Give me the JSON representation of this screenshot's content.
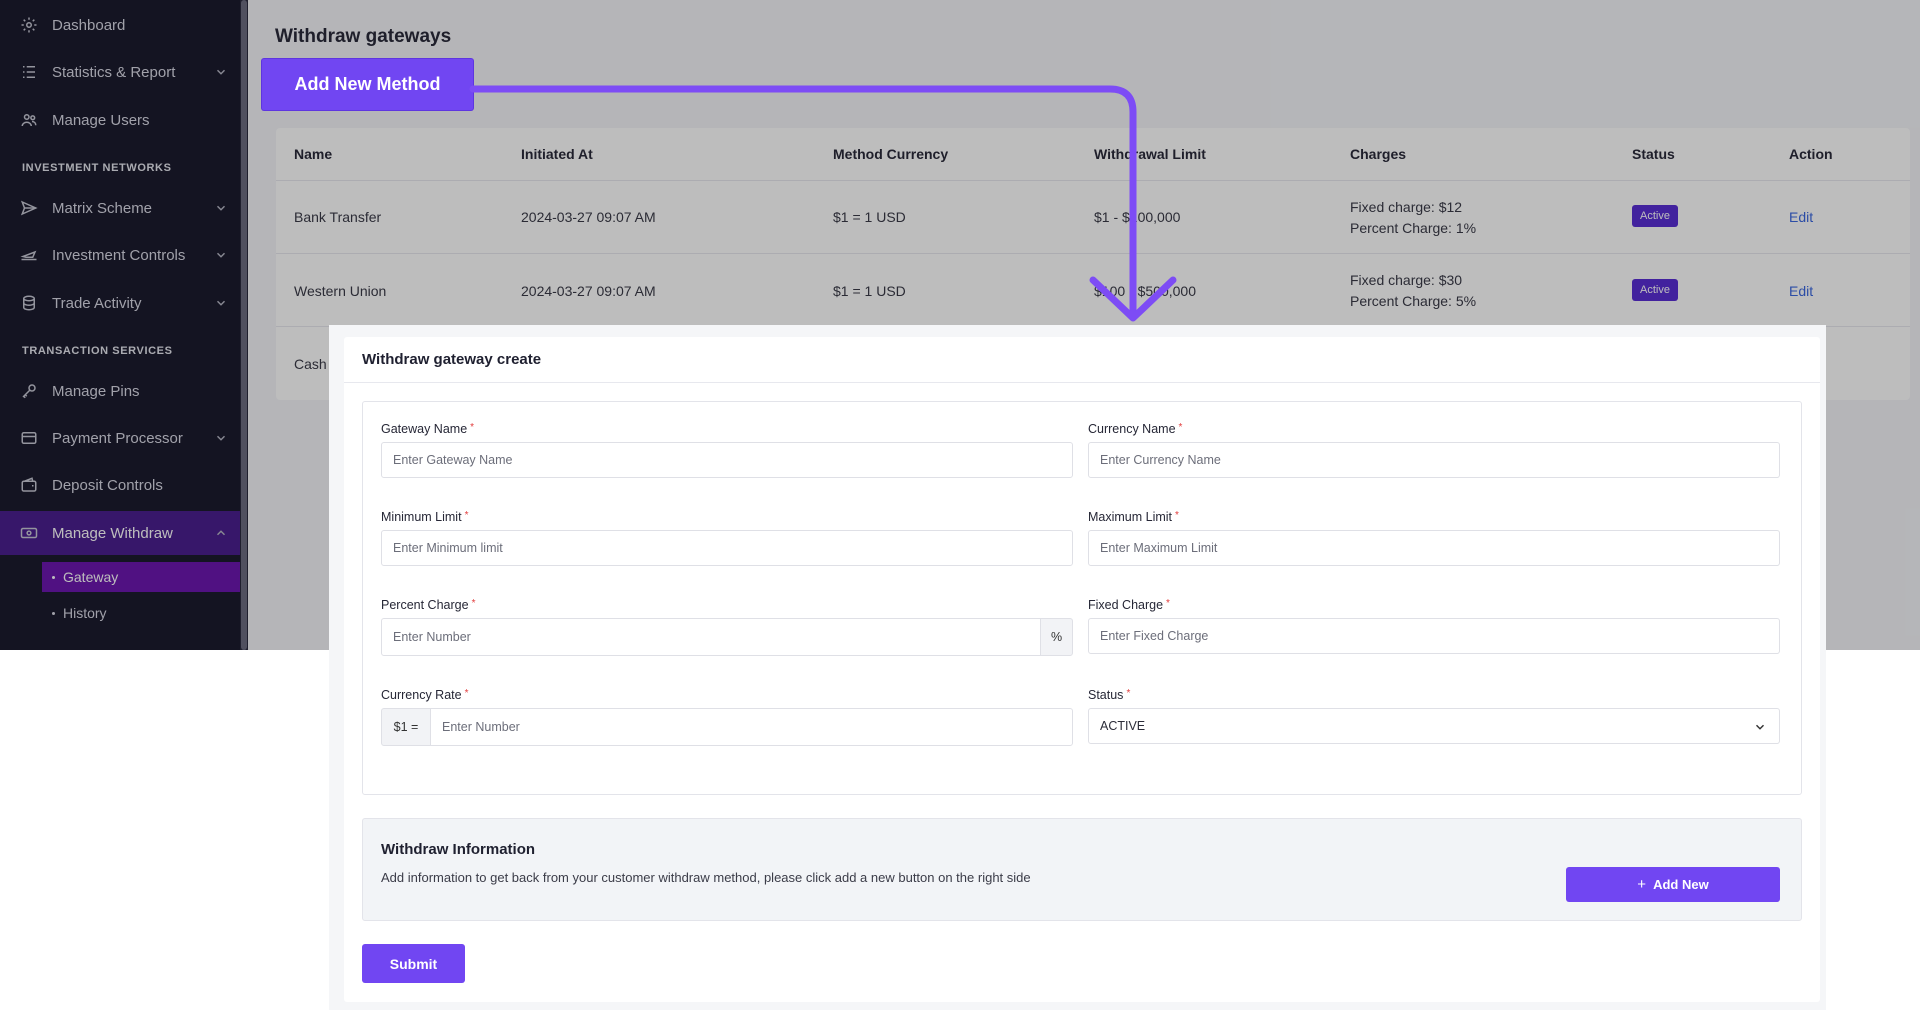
{
  "sidebar": {
    "items": [
      {
        "label": "Dashboard",
        "icon": "gear-icon"
      },
      {
        "label": "Statistics & Report",
        "icon": "list-icon"
      },
      {
        "label": "Manage Users",
        "icon": "users-icon"
      },
      {
        "label": "Matrix Scheme",
        "icon": "send-icon"
      },
      {
        "label": "Investment Controls",
        "icon": "plane-icon"
      },
      {
        "label": "Trade Activity",
        "icon": "database-icon"
      },
      {
        "label": "Manage Pins",
        "icon": "key-icon"
      },
      {
        "label": "Payment Processor",
        "icon": "card-icon"
      },
      {
        "label": "Deposit Controls",
        "icon": "wallet-icon"
      },
      {
        "label": "Manage Withdraw",
        "icon": "cash-icon"
      }
    ],
    "sections": [
      "INVESTMENT NETWORKS",
      "TRANSACTION SERVICES"
    ],
    "sub_items": [
      "Gateway",
      "History"
    ]
  },
  "page": {
    "title": "Withdraw gateways",
    "add_button": "Add New Method"
  },
  "table": {
    "headers": [
      "Name",
      "Initiated At",
      "Method Currency",
      "Withdrawal Limit",
      "Charges",
      "Status",
      "Action"
    ],
    "rows": [
      {
        "name": "Bank Transfer",
        "initiated": "2024-03-27 09:07 AM",
        "currency": "$1 = 1 USD",
        "limit": "$1 - $100,000",
        "fixed": "Fixed charge: $12",
        "percent": "Percent Charge: 1%",
        "status": "Active",
        "action": "Edit"
      },
      {
        "name": "Western Union",
        "initiated": "2024-03-27 09:07 AM",
        "currency": "$1 = 1 USD",
        "limit": "$100 - $500,000",
        "fixed": "Fixed charge: $30",
        "percent": "Percent Charge: 5%",
        "status": "Active",
        "action": "Edit"
      },
      {
        "name": "Cash"
      }
    ]
  },
  "modal": {
    "title": "Withdraw gateway create",
    "fields": {
      "gateway_name": {
        "label": "Gateway Name",
        "placeholder": "Enter Gateway Name"
      },
      "currency_name": {
        "label": "Currency Name",
        "placeholder": "Enter Currency Name"
      },
      "min_limit": {
        "label": "Minimum Limit",
        "placeholder": "Enter Minimum limit"
      },
      "max_limit": {
        "label": "Maximum Limit",
        "placeholder": "Enter Maximum Limit"
      },
      "percent_charge": {
        "label": "Percent Charge",
        "placeholder": "Enter Number",
        "addon": "%"
      },
      "fixed_charge": {
        "label": "Fixed Charge",
        "placeholder": "Enter Fixed Charge"
      },
      "currency_rate": {
        "label": "Currency Rate",
        "placeholder": "Enter Number",
        "addon": "$1 ="
      },
      "status": {
        "label": "Status",
        "value": "ACTIVE"
      }
    },
    "required_mark": "*",
    "info": {
      "title": "Withdraw Information",
      "text": "Add information to get back from your customer withdraw method, please click add a new button on the right side",
      "add_button": "Add New",
      "add_icon": "+"
    },
    "submit": "Submit"
  },
  "colors": {
    "accent": "#7146f2",
    "sidebar_bg": "#1c1b2e",
    "active_nav": "#4b1f8f",
    "active_sub": "#6c18b0",
    "badge": "#5a2fd6",
    "link": "#3c68e0"
  }
}
